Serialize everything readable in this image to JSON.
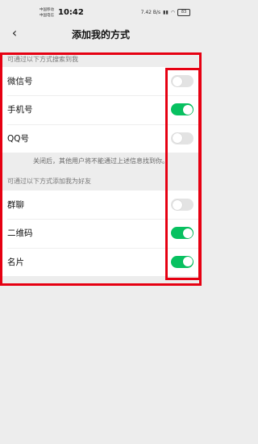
{
  "status": {
    "carrier1": "中国移动",
    "carrier2": "中国电信",
    "time": "10:42",
    "speed": "7.42 B/s",
    "battery": "83"
  },
  "nav": {
    "back_icon": "chevron-left-icon",
    "title": "添加我的方式"
  },
  "search_section": {
    "heading": "可通过以下方式搜索到我",
    "items": [
      {
        "label": "微信号",
        "on": false
      },
      {
        "label": "手机号",
        "on": true
      },
      {
        "label": "QQ号",
        "on": false
      }
    ],
    "note": "关闭后，其他用户将不能通过上述信息找到你。"
  },
  "add_section": {
    "heading": "可通过以下方式添加我为好友",
    "items": [
      {
        "label": "群聊",
        "on": false
      },
      {
        "label": "二维码",
        "on": true
      },
      {
        "label": "名片",
        "on": true
      }
    ]
  },
  "colors": {
    "toggle_on": "#07c160",
    "toggle_off": "#e3e3e3",
    "highlight": "#e60012"
  }
}
